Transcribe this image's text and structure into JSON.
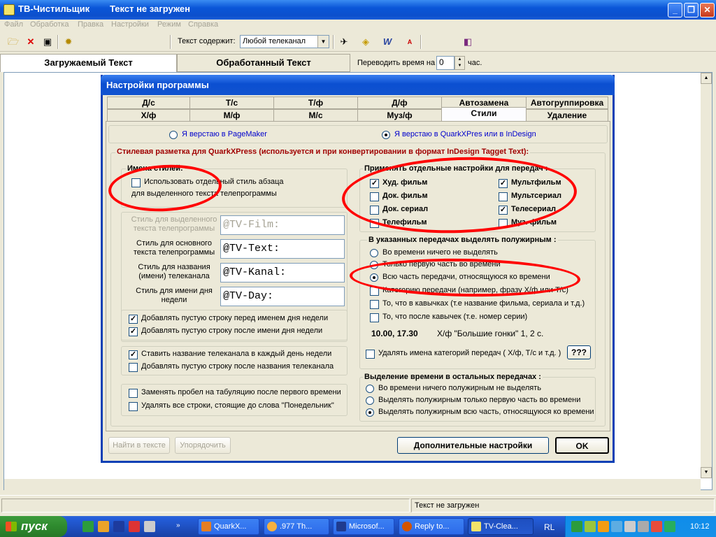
{
  "window": {
    "app_title": "ТВ-Чистильщик",
    "doc_title": "Текст не загружен"
  },
  "menu": [
    "Файл",
    "Обработка",
    "Правка",
    "Настройки",
    "Режим",
    "Справка"
  ],
  "toolbar": {
    "text_contains_label": "Текст содержит:",
    "channel_combo_value": "Любой телеканал",
    "shift_time_label": "Переводить время на",
    "shift_time_value": "0",
    "shift_time_unit": "час."
  },
  "main_tabs": [
    "Загружаемый Текст",
    "Обработанный Текст"
  ],
  "status": {
    "text": "Текст не загружен"
  },
  "dialog": {
    "title": "Настройки программы",
    "tabs_row1": [
      "Д/с",
      "Т/с",
      "Т/ф",
      "Д/ф",
      "Автозамена",
      "Автогруппировка"
    ],
    "tabs_row2": [
      "Х/ф",
      "М/ф",
      "М/с",
      "Муз/ф",
      "Стили",
      "Удаление"
    ],
    "layout_pagemaker": "Я верстаю в PageMaker",
    "layout_quark": "Я верстаю в QuarkXPres или в InDesign",
    "quark_group_label": "Стилевая разметка для QuarkXPress  (используется и при конвертировании в формат InDesign Tagget Text):",
    "style_names_label": "Имена стилей:",
    "separate_style_label_1": "Использовать отдельный стиль абзаца",
    "separate_style_label_2": "для выделенного текста телепрограммы",
    "styles": [
      {
        "label": "Стиль для выделенного текста телепрограммы",
        "value": "@TV-Film:"
      },
      {
        "label": "Стиль для основного текста телепрограммы",
        "value": "@TV-Text:"
      },
      {
        "label": "Стиль для названия (имени) телеканала",
        "value": "@TV-Kanal:"
      },
      {
        "label": "Стиль  для имени дня недели",
        "value": "@TV-Day:"
      }
    ],
    "opts_day": [
      "Добавлять пустую строку перед именем дня недели",
      "Добавлять пустую строку после имени дня недели"
    ],
    "opts_channel": [
      "Ставить название телеканала в каждый день недели",
      "Добавлять пустую строку после названия телеканала"
    ],
    "opts_misc": [
      "Заменять пробел на табуляцию после первого времени",
      "Удалять все строки,  стоящие  до  слова  \"Понедельник\""
    ],
    "apply_label": "Применять отдельные настройки для передач :",
    "categories": [
      {
        "label": "Худ. фильм",
        "checked": true
      },
      {
        "label": "Мультфильм",
        "checked": true
      },
      {
        "label": "Док. фильм",
        "checked": false
      },
      {
        "label": "Мультсериал",
        "checked": false
      },
      {
        "label": "Док. сериал",
        "checked": false
      },
      {
        "label": "Телесериал",
        "checked": true
      },
      {
        "label": "Телефильм",
        "checked": false
      },
      {
        "label": "Муз. фильм",
        "checked": false
      }
    ],
    "bold_label": "В указанных передачах выделять полужирным :",
    "bold_opts": [
      "Во времени ничего не выделять",
      "Только первую часть во времени",
      "Всю часть передачи, относящуюся ко времени",
      "Категорию передачи  (например, фразу Х/ф или Т/с)",
      "То, что в кавычках (т.е название фильма, сериала и т.д.)",
      "То, что после кавычек (т.е. номер серии)"
    ],
    "example": {
      "times": "10.00,  17.30",
      "rest": "Х/ф  \"Большие гонки\"  1, 2 с."
    },
    "remove_categories_label": "Удалять имена категорий передач ( Х/ф, Т/с и т.д. )",
    "help_button": "???",
    "other_label": "Выделение времени в остальных передачах :",
    "other_opts": [
      "Во времени ничего полужирным не выделять",
      "Выделять полужирным только первую часть во времени",
      "Выделять полужирным всю часть, относящуюся ко времени"
    ],
    "find_button": "Найти в тексте",
    "sort_button": "Упорядочить",
    "more_button": "Дополнительные настройки",
    "ok_button": "OK"
  },
  "taskbar": {
    "start": "пуск",
    "tasks": [
      "QuarkX...",
      ".977 Th...",
      "Microsof...",
      "Reply to...",
      "TV-Clea..."
    ],
    "lang": "RL",
    "clock": "10:12"
  },
  "colors": {
    "title_blue": "#0a56d8",
    "annotation_red": "#ff0000",
    "dialog_blue_text": "#0000cc",
    "dialog_red_text": "#a00000"
  }
}
